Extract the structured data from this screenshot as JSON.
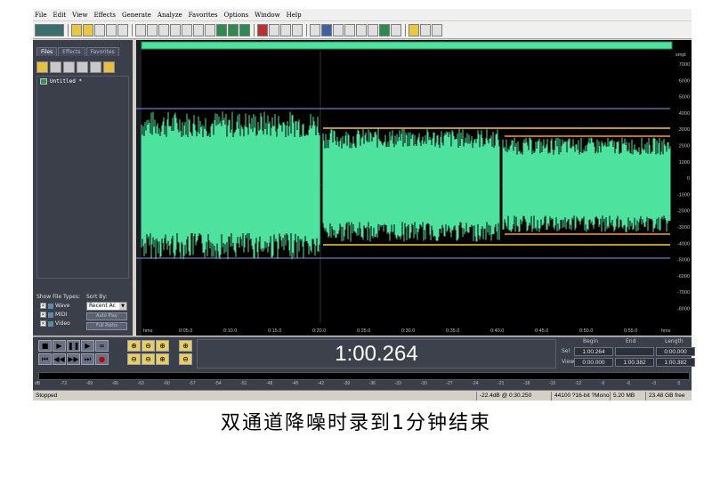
{
  "menu": [
    "File",
    "Edit",
    "View",
    "Effects",
    "Generate",
    "Analyze",
    "Favorites",
    "Options",
    "Window",
    "Help"
  ],
  "left_panel": {
    "tabs": [
      "Files",
      "Effects",
      "Favorites"
    ],
    "files": [
      "Untitled *"
    ],
    "show_file_types_label": "Show File Types:",
    "sort_by_label": "Sort By:",
    "file_types": [
      "Wave",
      "MIDI",
      "Video"
    ],
    "sort_value": "Recent Ac",
    "auto_play_label": "Auto Play",
    "full_paths_label": "Full Paths"
  },
  "wave": {
    "ruler_unit": "smpl",
    "ruler_labels": [
      "7000",
      "6000",
      "5000",
      "4000",
      "3000",
      "2000",
      "1000",
      "0",
      "-1000",
      "-2000",
      "-3000",
      "-4000",
      "-5000",
      "-6000",
      "-7000",
      "-8000"
    ],
    "timeline_start": "hms",
    "timeline_labels": [
      "0:05.0",
      "0:10.0",
      "0:15.0",
      "0:20.0",
      "0:25.0",
      "0:30.0",
      "0:35.0",
      "0:40.0",
      "0:45.0",
      "0:50.0",
      "0:55.0"
    ],
    "timeline_end": "hms",
    "colors": {
      "waveform": "#4de39f",
      "background": "#000000",
      "envelope": "#ffd000",
      "envelope_alt": "#ff9a1a",
      "limit_line": "#6e78c8"
    }
  },
  "transport": {
    "time": "1:00.264"
  },
  "selection": {
    "headers": [
      "Begin",
      "End",
      "Length"
    ],
    "sel_label": "Sel",
    "view_label": "View",
    "sel": [
      "1:00.264",
      "",
      "0:00.000"
    ],
    "view": [
      "0:00.000",
      "1:00.382",
      "1:00.382"
    ]
  },
  "meter": {
    "labels": [
      "dB",
      "-72",
      "-69",
      "-66",
      "-63",
      "-60",
      "-57",
      "-54",
      "-51",
      "-48",
      "-45",
      "-42",
      "-39",
      "-36",
      "-33",
      "-30",
      "-27",
      "-24",
      "-21",
      "-18",
      "-15",
      "-12",
      "-9",
      "-6",
      "-3",
      "0"
    ]
  },
  "status": {
    "state": "Stopped",
    "level": "-22.4dB @  0:30.250",
    "format": "44100 ?16-bit ?Mono",
    "size": "5.20 MB",
    "free": "23.48 GB free"
  },
  "caption": "双通道降噪时录到1分钟结束"
}
